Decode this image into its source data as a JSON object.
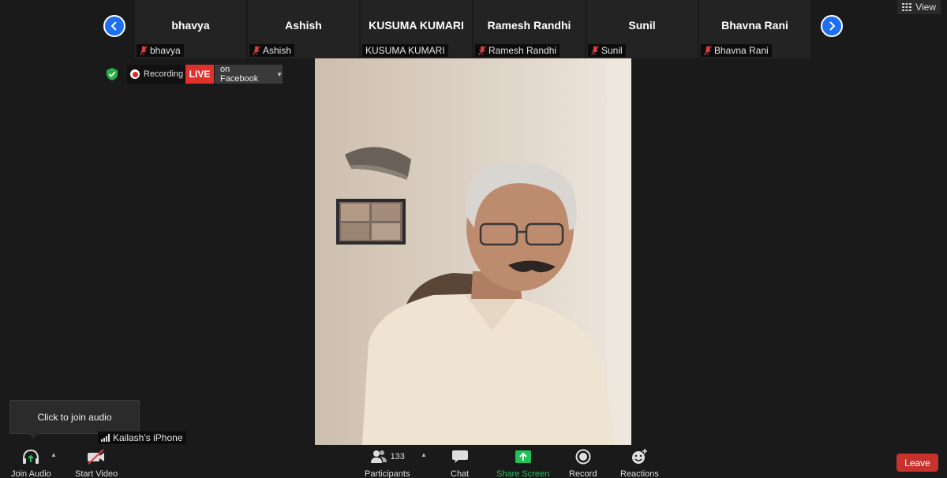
{
  "strip": {
    "participants": [
      {
        "name": "bhavya",
        "label": "bhavya",
        "muted": true
      },
      {
        "name": "Ashish",
        "label": "Ashish",
        "muted": true
      },
      {
        "name": "KUSUMA KUMARI",
        "label": "KUSUMA KUMARI",
        "muted": false
      },
      {
        "name": "Ramesh Randhi",
        "label": "Ramesh Randhi",
        "muted": true
      },
      {
        "name": "Sunil",
        "label": "Sunil",
        "muted": true
      },
      {
        "name": "Bhavna Rani",
        "label": "Bhavna Rani",
        "muted": true
      }
    ]
  },
  "view": {
    "label": "View"
  },
  "status": {
    "recording": "Recording",
    "live": "LIVE",
    "live_platform": "on Facebook"
  },
  "tooltip": {
    "text": "Click to join audio"
  },
  "device": {
    "label": "Kailash’s iPhone"
  },
  "toolbar": {
    "join_audio": "Join Audio",
    "start_video": "Start Video",
    "participants": "Participants",
    "participants_count": "133",
    "chat": "Chat",
    "share_screen": "Share Screen",
    "record": "Record",
    "reactions": "Reactions",
    "leave": "Leave"
  },
  "colors": {
    "accent_blue": "#1e6ff2",
    "live_red": "#e0302c",
    "share_green": "#22c25a",
    "leave_red": "#c8322d",
    "shield_green": "#28b04a"
  }
}
